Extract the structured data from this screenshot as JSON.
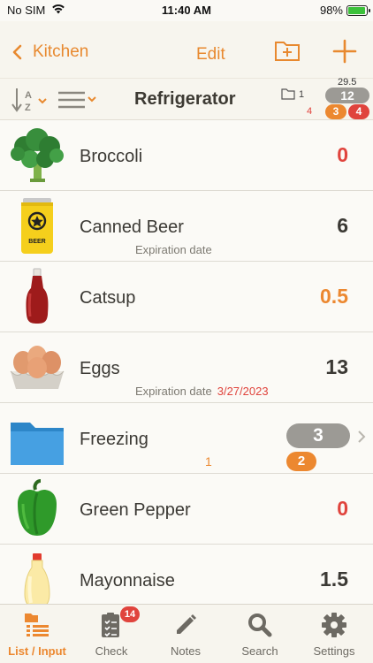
{
  "status": {
    "carrier": "No SIM",
    "time": "11:40 AM",
    "battery": "98%",
    "battery_level": 0.98
  },
  "nav": {
    "back_label": "Kitchen",
    "edit_label": "Edit"
  },
  "toolbar": {
    "title": "Refrigerator",
    "folder_count": "1",
    "red_count": "4",
    "total_weight": "29.5",
    "total_items": "12",
    "orange_count": "3",
    "red_badge": "4"
  },
  "items": [
    {
      "name": "Broccoli",
      "qty": "0",
      "qty_color": "red",
      "icon": "broccoli-icon"
    },
    {
      "name": "Canned Beer",
      "qty": "6",
      "qty_color": "dark",
      "icon": "beer-can-icon",
      "sub_label": "Expiration date",
      "sub_date": ""
    },
    {
      "name": "Catsup",
      "qty": "0.5",
      "qty_color": "orange",
      "icon": "ketchup-icon"
    },
    {
      "name": "Eggs",
      "qty": "13",
      "qty_color": "dark",
      "icon": "eggs-icon",
      "sub_label": "Expiration date",
      "sub_date": "3/27/2023"
    },
    {
      "name": "Freezing",
      "icon": "folder-icon",
      "folder": true,
      "folder_sub": "1",
      "gray_count": "3",
      "orange_count": "2"
    },
    {
      "name": "Green Pepper",
      "qty": "0",
      "qty_color": "red",
      "icon": "green-pepper-icon"
    },
    {
      "name": "Mayonnaise",
      "qty": "1.5",
      "qty_color": "dark",
      "icon": "mayonnaise-icon"
    }
  ],
  "tabs": [
    {
      "label": "List / Input",
      "icon": "list-input-icon",
      "active": true
    },
    {
      "label": "Check",
      "icon": "checklist-icon",
      "badge": "14"
    },
    {
      "label": "Notes",
      "icon": "pencil-icon"
    },
    {
      "label": "Search",
      "icon": "search-icon"
    },
    {
      "label": "Settings",
      "icon": "gear-icon"
    }
  ],
  "colors": {
    "accent": "#ec8830",
    "alert": "#e0443d",
    "neutral_pill": "#9c9a95"
  }
}
